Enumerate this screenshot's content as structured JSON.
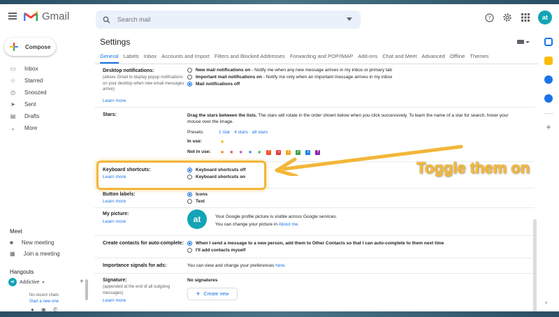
{
  "header": {
    "app_name": "Gmail",
    "search_placeholder": "Search mail",
    "avatar_initials": "at"
  },
  "nav": {
    "compose_label": "Compose",
    "items": [
      {
        "label": "Inbox",
        "icon": "inbox-icon"
      },
      {
        "label": "Starred",
        "icon": "star-icon"
      },
      {
        "label": "Snoozed",
        "icon": "clock-icon"
      },
      {
        "label": "Sent",
        "icon": "send-icon"
      },
      {
        "label": "Drafts",
        "icon": "draft-icon"
      },
      {
        "label": "More",
        "icon": "chevron-down-icon"
      }
    ],
    "meet_title": "Meet",
    "meet_items": [
      "New meeting",
      "Join a meeting"
    ],
    "hangouts_title": "Hangouts",
    "hangouts_user": "Addictive",
    "no_recent_chats": "No recent chats",
    "start_new": "Start a new one"
  },
  "settings": {
    "title": "Settings",
    "tabs": [
      "General",
      "Labels",
      "Inbox",
      "Accounts and Import",
      "Filters and Blocked Addresses",
      "Forwarding and POP/IMAP",
      "Add-ons",
      "Chat and Meet",
      "Advanced",
      "Offline",
      "Themes"
    ],
    "desktop": {
      "label": "Desktop notifications:",
      "sub": "(allows Gmail to display popup notifications on your desktop when new email messages arrive)",
      "learn_more": "Learn more",
      "options": [
        {
          "bold": "New mail notifications on",
          "rest": " - Notify me when any new message arrives in my inbox or primary tab",
          "selected": false
        },
        {
          "bold": "Important mail notifications on",
          "rest": " - Notify me only when an important message arrives in my inbox",
          "selected": false
        },
        {
          "bold": "Mail notifications off",
          "rest": "",
          "selected": true
        }
      ]
    },
    "stars": {
      "label": "Stars:",
      "desc_bold": "Drag the stars between the lists.",
      "desc_rest": " The stars will rotate in the order shown below when you click successively. To learn the name of a star for search, hover your mouse over the image.",
      "presets_label": "Presets:",
      "presets": [
        "1 star",
        "4 stars",
        "all stars"
      ],
      "in_use_label": "In use:",
      "not_in_use_label": "Not in use:",
      "in_use_color": "#f4b400",
      "not_in_use_stars": [
        "#f57c00",
        "#e53935",
        "#ab47bc",
        "#1e88e5",
        "#43a047"
      ],
      "not_in_use_squares": [
        {
          "color": "#f4511e",
          "glyph": "!"
        },
        {
          "color": "#e53935",
          "glyph": "»"
        },
        {
          "color": "#f9a825",
          "glyph": "!"
        },
        {
          "color": "#43a047",
          "glyph": "✓"
        },
        {
          "color": "#1e88e5",
          "glyph": "i"
        },
        {
          "color": "#8e24aa",
          "glyph": "?"
        }
      ]
    },
    "keyboard": {
      "label": "Keyboard shortcuts:",
      "learn_more": "Learn more",
      "options": [
        {
          "label": "Keyboard shortcuts off",
          "selected": true
        },
        {
          "label": "Keyboard shortcuts on",
          "selected": false
        }
      ]
    },
    "button_labels": {
      "label": "Button labels:",
      "learn_more": "Learn more",
      "options": [
        {
          "label": "Icons",
          "selected": true
        },
        {
          "label": "Text",
          "selected": false
        }
      ]
    },
    "my_picture": {
      "label": "My picture:",
      "learn_more": "Learn more",
      "line1": "Your Google profile picture is visible across Google services.",
      "line2_prefix": "You can change your picture in ",
      "line2_link": "About me",
      "line2_suffix": ".",
      "initials": "at"
    },
    "contacts": {
      "label": "Create contacts for auto-complete:",
      "options": [
        {
          "label": "When I send a message to a new person, add them to Other Contacts so that I can auto-complete to them next time",
          "selected": true
        },
        {
          "label": "I'll add contacts myself",
          "selected": false
        }
      ]
    },
    "importance": {
      "label": "Importance signals for ads:",
      "text_prefix": "You can view and change your preferences ",
      "text_link": "here",
      "text_suffix": "."
    },
    "signature": {
      "label": "Signature:",
      "sub": "(appended at the end of all outgoing messages)",
      "learn_more": "Learn more",
      "value": "No signatures",
      "create_new": "Create new"
    }
  },
  "annotation": {
    "text": "Toggle them on",
    "color": "#f6b83a"
  }
}
